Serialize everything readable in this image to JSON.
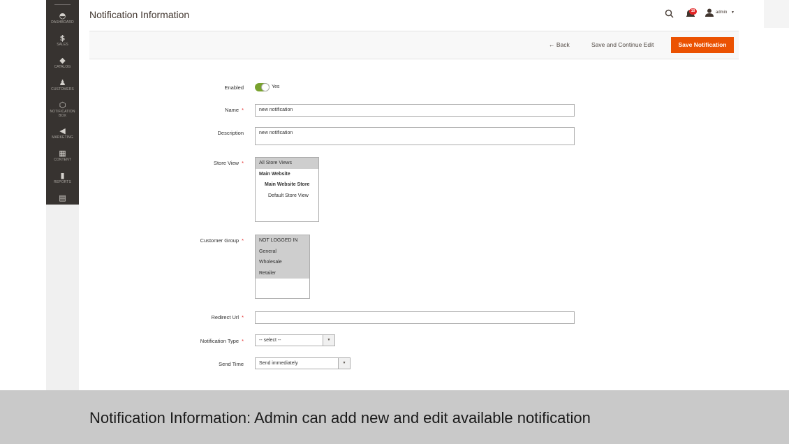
{
  "sidebar": {
    "items": [
      {
        "label": "DASHBOARD",
        "icon": "dashboard-icon",
        "glyph": "◓"
      },
      {
        "label": "SALES",
        "icon": "dollar-icon",
        "glyph": "$"
      },
      {
        "label": "CATALOG",
        "icon": "cube-icon",
        "glyph": "◆"
      },
      {
        "label": "CUSTOMERS",
        "icon": "person-icon",
        "glyph": "♟"
      },
      {
        "label": "NOTIFICATION",
        "label2": "BOX",
        "icon": "hexagon-icon",
        "glyph": "⬡"
      },
      {
        "label": "MARKETING",
        "icon": "megaphone-icon",
        "glyph": "◀"
      },
      {
        "label": "CONTENT",
        "icon": "content-icon",
        "glyph": "▦"
      },
      {
        "label": "REPORTS",
        "icon": "bar-chart-icon",
        "glyph": "▮"
      },
      {
        "label": "",
        "icon": "store-icon",
        "glyph": "▤"
      }
    ]
  },
  "header": {
    "title": "Notification Information",
    "notification_count": "10",
    "user": "admin"
  },
  "actions": {
    "back": "← Back",
    "save_continue": "Save and Continue Edit",
    "save": "Save Notification"
  },
  "form": {
    "enabled": {
      "label": "Enabled",
      "value": "Yes"
    },
    "name": {
      "label": "Name",
      "value": "new notification"
    },
    "description": {
      "label": "Description",
      "value": "new notification"
    },
    "store_view": {
      "label": "Store View",
      "options": [
        "All Store Views",
        "Main Website",
        "Main Website Store",
        "Default Store View"
      ]
    },
    "customer_group": {
      "label": "Customer Group",
      "options": [
        "NOT LOGGED IN",
        "General",
        "Wholesale",
        "Retailer"
      ]
    },
    "redirect_url": {
      "label": "Redirect Url",
      "value": ""
    },
    "notification_type": {
      "label": "Notification Type",
      "value": "-- select --"
    },
    "send_time": {
      "label": "Send Time",
      "value": "Send immediately"
    }
  },
  "caption": "Notification Information: Admin can add new and edit available notification",
  "colors": {
    "accent": "#eb5202",
    "sidebar": "#373330",
    "toggle_on": "#79a22e",
    "required": "#e22626"
  }
}
